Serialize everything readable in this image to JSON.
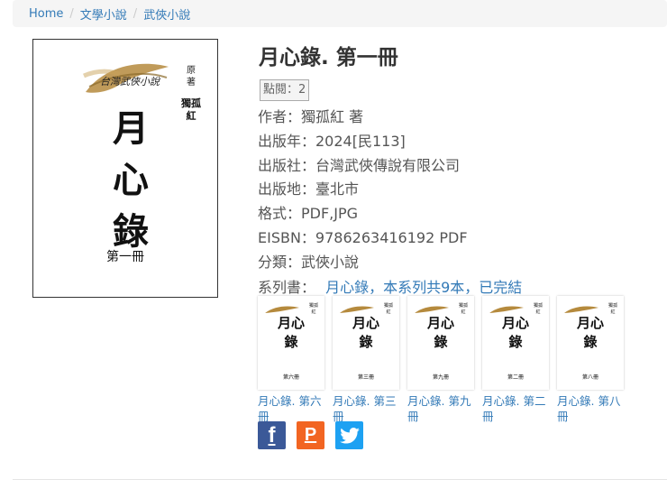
{
  "breadcrumb": {
    "home": "Home",
    "category": "文學小說",
    "subcategory": "武俠小說"
  },
  "cover": {
    "logo_text": "台灣武俠小說",
    "author_label_1": "原",
    "author_label_2": "著",
    "author_name": "獨孤紅",
    "title_chars": "月心錄",
    "volume": "第一冊"
  },
  "book": {
    "title": "月心錄. 第一冊",
    "hits": "點閱：2",
    "author": "作者：獨孤紅 著",
    "year": "出版年：2024[民113]",
    "publisher": "出版社：台灣武俠傳說有限公司",
    "place": "出版地：臺北市",
    "format": "格式：PDF,JPG",
    "eisbn": "EISBN：9786263416192 PDF",
    "category": "分類：武俠小說",
    "series_label": "系列書：",
    "series_link": "月心錄，本系列共9本，已完結"
  },
  "series": [
    {
      "caption": "月心錄. 第六冊",
      "vol": "第六冊"
    },
    {
      "caption": "月心錄. 第三冊",
      "vol": "第三冊"
    },
    {
      "caption": "月心錄. 第九冊",
      "vol": "第九冊"
    },
    {
      "caption": "月心錄. 第二冊",
      "vol": "第二冊"
    },
    {
      "caption": "月心錄. 第八冊",
      "vol": "第八冊"
    }
  ],
  "share": {
    "facebook_icon": "facebook-icon",
    "plurk_icon": "plurk-icon",
    "twitter_icon": "twitter-icon",
    "facebook_glyph": "f",
    "plurk_glyph": "P"
  },
  "colors": {
    "link": "#337ab7",
    "facebook": "#3b5998",
    "plurk": "#f26522",
    "twitter": "#1da1f2"
  }
}
